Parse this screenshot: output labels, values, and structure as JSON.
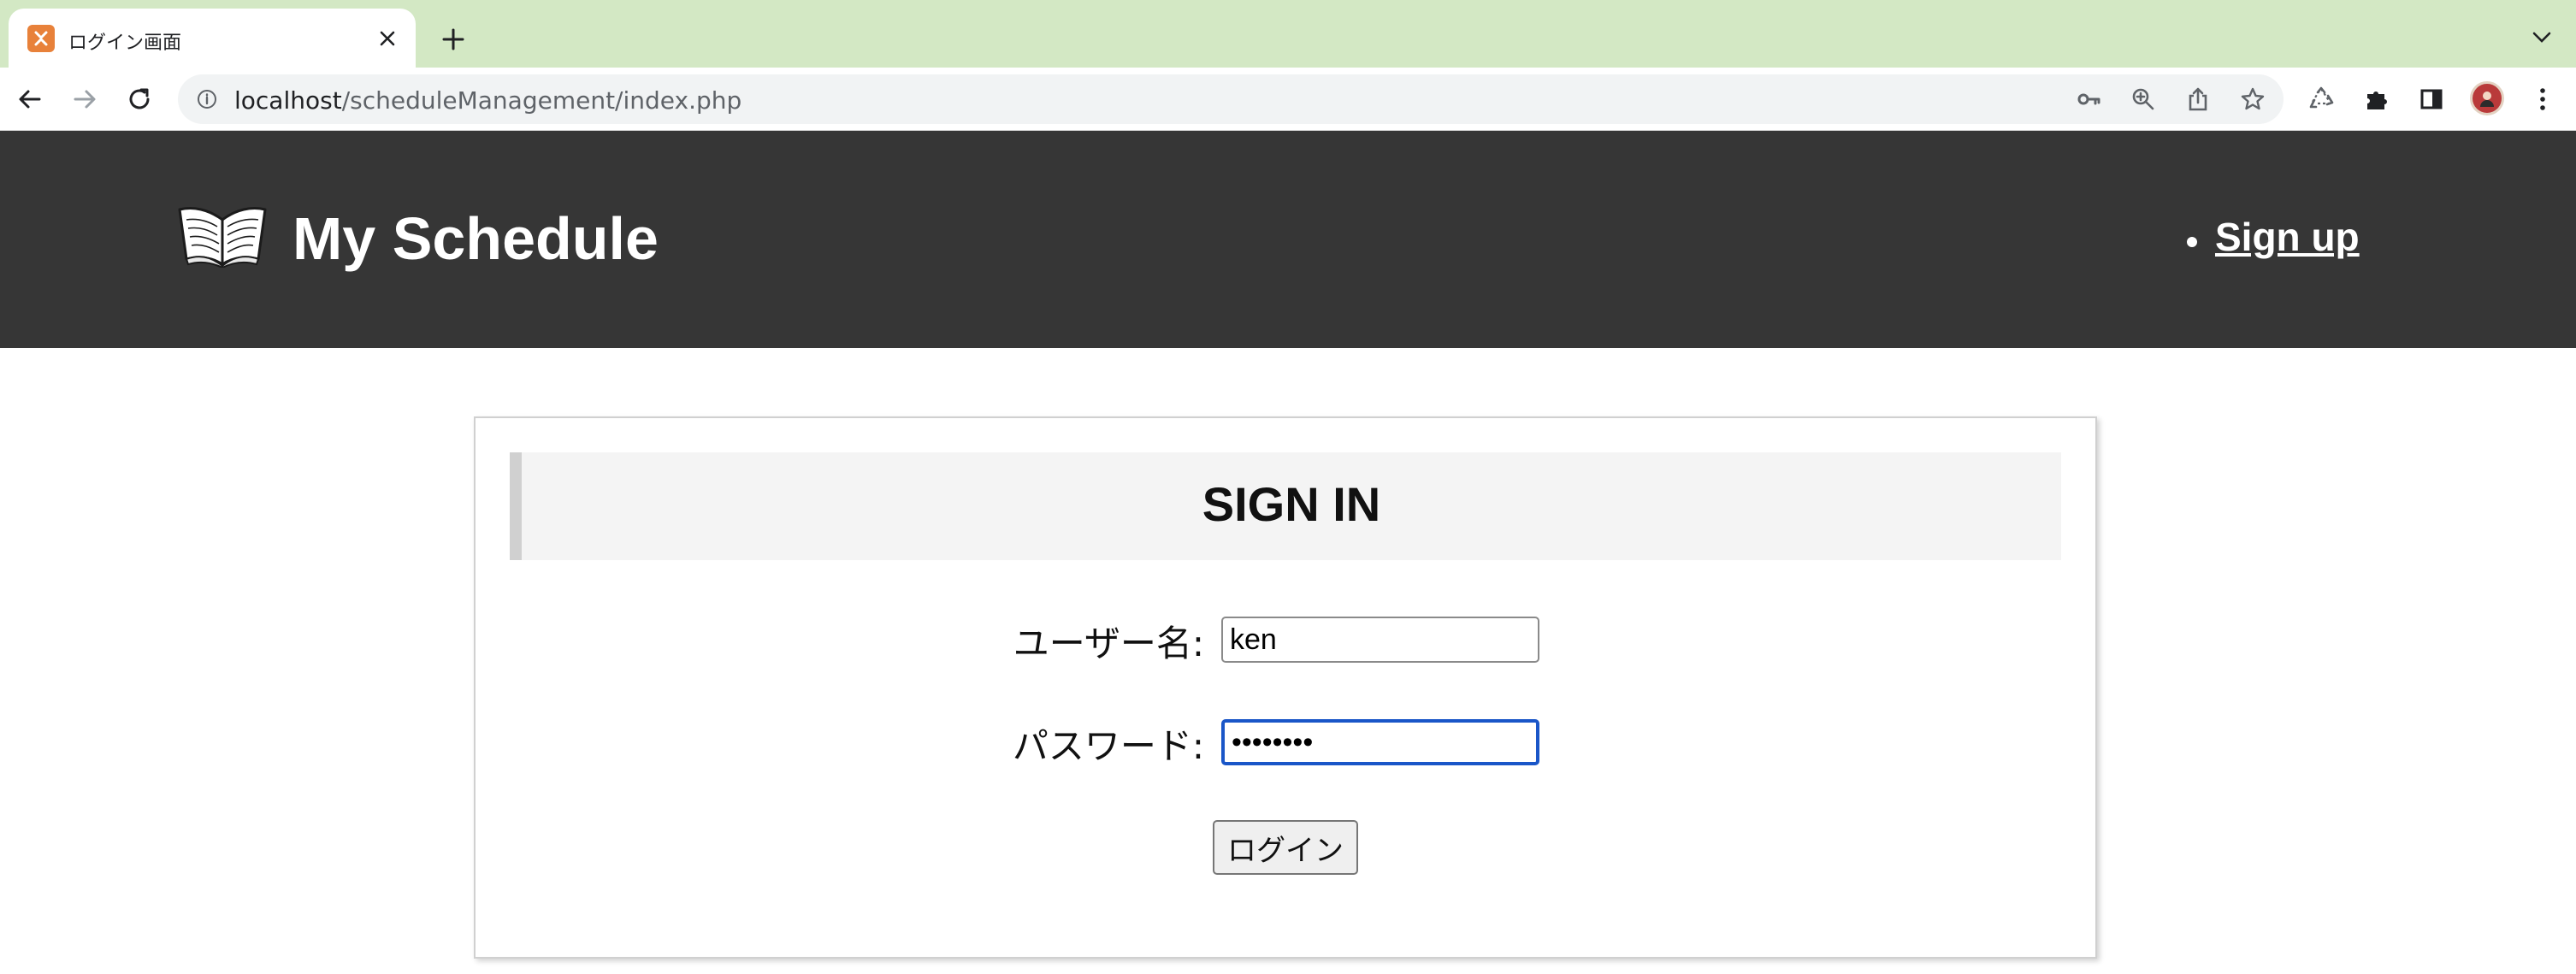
{
  "browser": {
    "tab": {
      "title": "ログイン画面",
      "favicon": "xampp-icon"
    },
    "address_bar": {
      "host": "localhost",
      "path": "/scheduleManagement/index.php"
    },
    "toolbar_icons": [
      "back-icon",
      "forward-icon",
      "reload-icon",
      "info-icon",
      "key-icon",
      "zoom-icon",
      "share-icon",
      "star-icon",
      "recycle-icon",
      "puzzle-icon",
      "sidepanel-icon",
      "avatar",
      "more-icon"
    ],
    "theme_color": "#d3e8c4"
  },
  "site": {
    "title": "My Schedule",
    "nav": {
      "signup_label": "Sign up"
    },
    "header_color": "#363636"
  },
  "signin": {
    "heading": "SIGN IN",
    "username_label": "ユーザー名:",
    "username_value": "ken",
    "password_label": "パスワード:",
    "password_value": "password",
    "submit_label": "ログイン"
  }
}
